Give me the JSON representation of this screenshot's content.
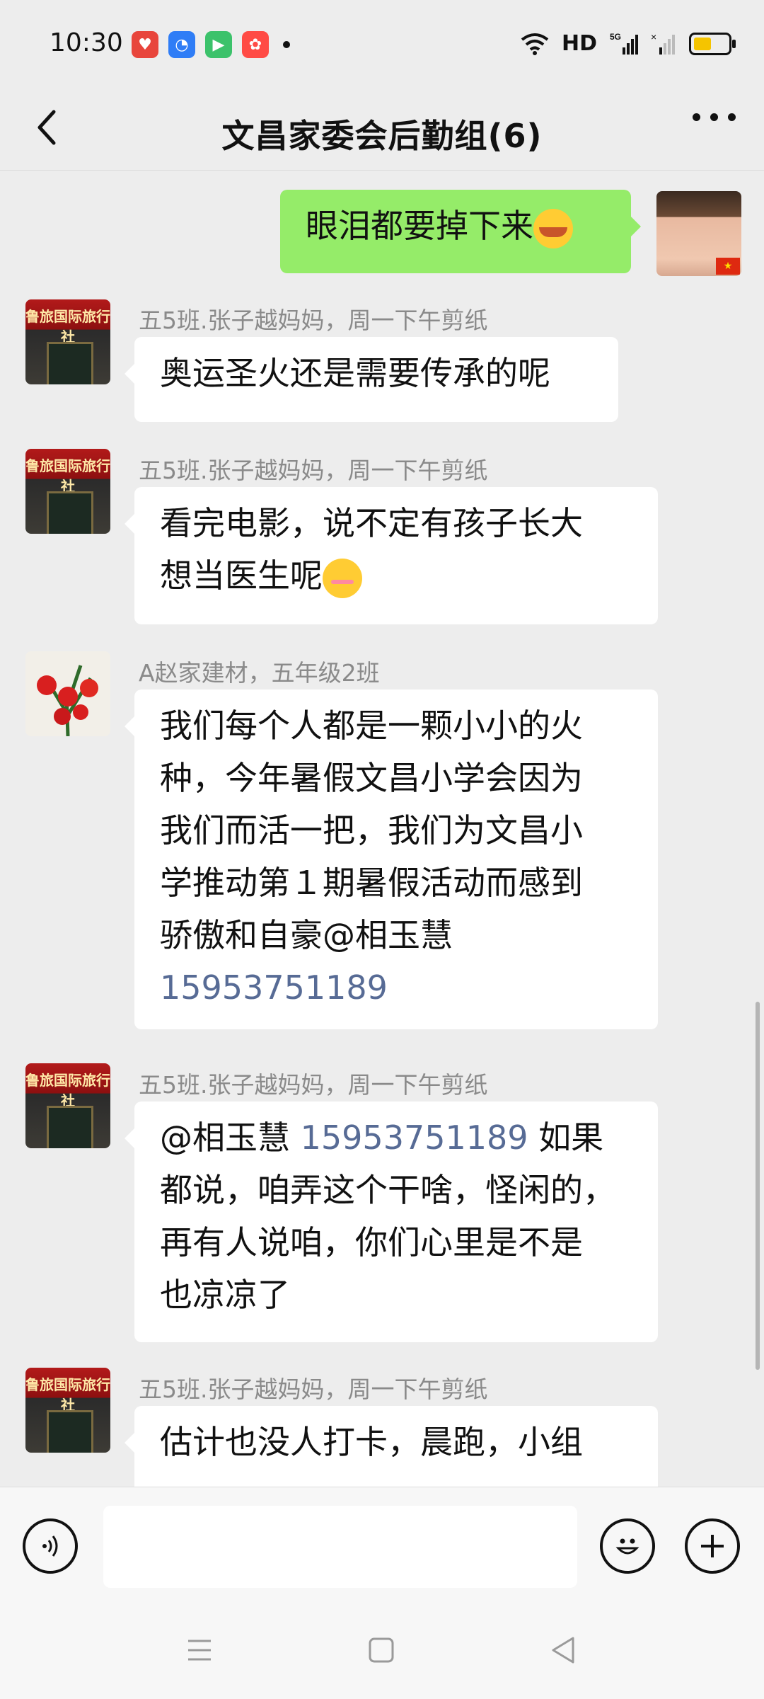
{
  "status_bar": {
    "time": "10:30",
    "network": "HD",
    "network_sub": "5G"
  },
  "header": {
    "title": "文昌家委会后勤组(6)"
  },
  "messages": [
    {
      "sender": "",
      "text": "眼泪都要掉下来",
      "self": true
    },
    {
      "sender": "五5班.张子越妈妈，周一下午剪纸",
      "text": "奥运圣火还是需要传承的呢"
    },
    {
      "sender": "五5班.张子越妈妈，周一下午剪纸",
      "line1": "看完电影，说不定有孩子长大",
      "line2": "想当医生呢"
    },
    {
      "sender": "A赵家建材，五年级2班",
      "lines": [
        "我们每个人都是一颗小小的火",
        "种，今年暑假文昌小学会因为",
        "我们而活一把，我们为文昌小",
        "学推动第１期暑假活动而感到",
        "骄傲和自豪@相玉慧"
      ],
      "mention": "15953751189"
    },
    {
      "sender": "五5班.张子越妈妈，周一下午剪纸",
      "mention_name": "@相玉慧",
      "mention": "15953751189",
      "line1_tail": " 如果",
      "lines": [
        "都说，咱弄这个干啥，怪闲的，",
        "再有人说咱，你们心里是不是",
        "也凉凉了"
      ]
    },
    {
      "sender": "五5班.张子越妈妈，周一下午剪纸",
      "text": "估计也没人打卡，晨跑，小组"
    }
  ],
  "avatars": {
    "shop_sign": "鲁旅国际旅行社"
  },
  "colors": {
    "background": "#ededed",
    "self_bubble": "#95ec69",
    "mention": "#576b95"
  }
}
